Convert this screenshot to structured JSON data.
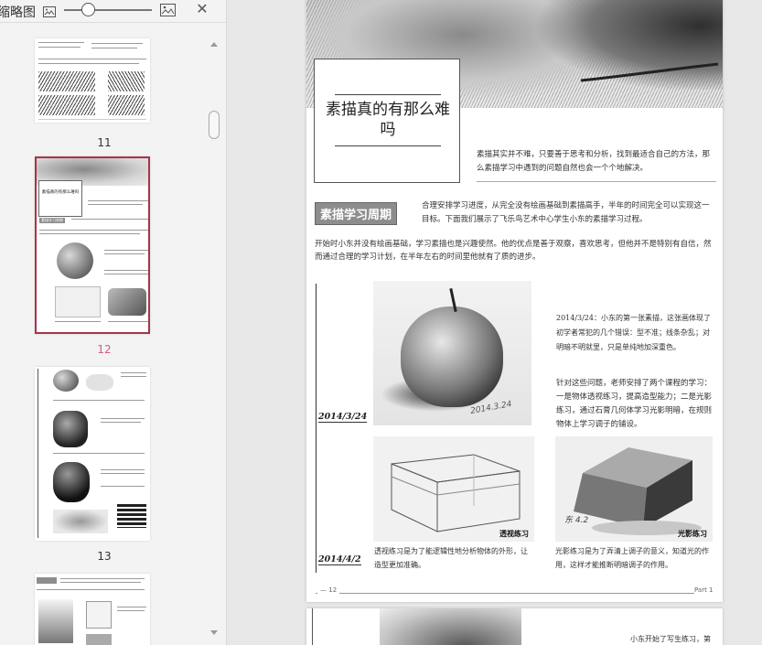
{
  "sidebar": {
    "title": "缩略图",
    "zoom_level": 0.2,
    "pages": [
      {
        "number": "11",
        "selected": false
      },
      {
        "number": "12",
        "selected": true
      },
      {
        "number": "13",
        "selected": false
      }
    ],
    "mini": {
      "p12_title": "素描真的有那么难吗",
      "p12_tag": "素描学习周期"
    }
  },
  "page": {
    "title": "素描真的有那么难吗",
    "intro": "素描其实并不难，只要善于思考和分析，找到最适合自己的方法，那么素描学习中遇到的问题自然也会一个个地解决。",
    "section_tag": "素描学习周期",
    "section_text": "合理安排学习进度，从完全没有绘画基础到素描高手，半年的时间完全可以实现这一目标。下面我们展示了飞乐鸟艺术中心学生小东的素描学习过程。",
    "body": "开始时小东并没有绘画基础，学习素描也是兴趣使然。他的优点是善于观察，喜欢思考，但他并不是特别有自信，然而通过合理的学习计划，在半年左右的时间里他就有了质的进步。",
    "date1": "2014/3/24",
    "date2": "2014/4/2",
    "apple_signature": "2014.3.24",
    "caption1": "2014/3/24：小东的第一张素描，这张画体现了初学者常犯的几个错误：型不准；线条杂乱；对明暗不明就里，只是单纯地加深重色。",
    "caption2": "针对这些问题，老师安排了两个课程的学习：一是物体透视练习，提高造型能力；二是光影练习，通过石膏几何体学习光影明暗，在规则物体上学习调子的铺设。",
    "label_box": "透视练习",
    "label_prism": "光影练习",
    "prism_signature": "东 4.2",
    "caption3": "透视练习是为了能逻辑性地分析物体的外形，让造型更加准确。",
    "caption4": "光影练习是为了弄清上调子的意义，知道光的作用，这样才能推断明暗调子的作用。",
    "footer_page": "12",
    "footer_part": "Part 1"
  },
  "page2": {
    "text": "小东开始了写生练习，第"
  },
  "colors": {
    "selected_border": "#a8344a",
    "selected_number": "#d85a78",
    "tag_bg": "#8d8d8d"
  },
  "icons": [
    "image-small-icon",
    "image-large-icon",
    "close-icon",
    "scroll-up-icon",
    "scroll-down-icon"
  ]
}
